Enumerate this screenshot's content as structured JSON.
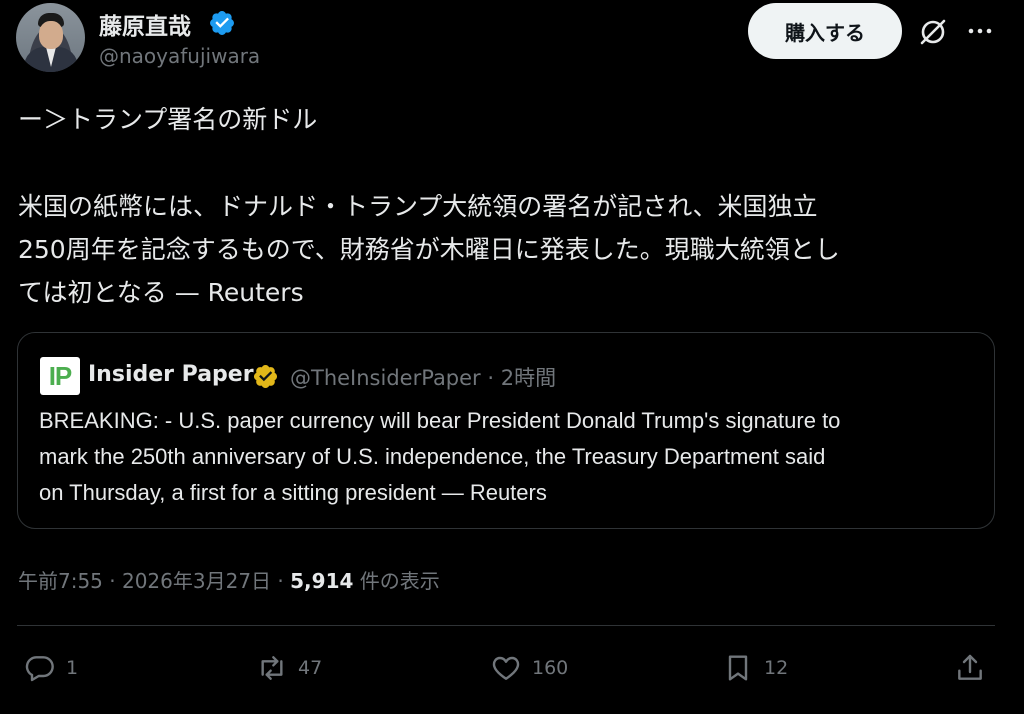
{
  "author": {
    "name": "藤原直哉",
    "handle": "@naoyafujiwara",
    "avatar_icon": "avatar-photo"
  },
  "header": {
    "buy_label": "購入する",
    "grok_icon": "grok-icon",
    "more_icon": "more-icon"
  },
  "tweet": {
    "line1": "ー＞トランプ署名の新ドル",
    "line2": "米国の紙幣には、ドナルド・トランプ大統領の署名が記され、米国独立",
    "line3": "250周年を記念するもので、財務省が木曜日に発表した。現職大統領とし",
    "line4": "ては初となる — Reuters"
  },
  "quote": {
    "logo_text": "IP",
    "name": "Insider Paper",
    "handle_time": "@TheInsiderPaper · 2時間",
    "line1": "BREAKING: - U.S. paper currency will bear President Donald Trump's signature to",
    "line2": "mark the 250th anniversary of U.S. independence, the Treasury Department said",
    "line3": "on Thursday, a first for a sitting president — Reuters"
  },
  "meta": {
    "time_date": "午前7:55 · 2026年3月27日 · ",
    "views": "5,914",
    "views_label": " 件の表示"
  },
  "actions": {
    "replies": "1",
    "reposts": "47",
    "likes": "160",
    "bookmarks": "12"
  },
  "colors": {
    "background": "#000000",
    "text": "#e7e9ea",
    "muted": "#71767b",
    "verified_blue": "#1d9bf0",
    "verified_gold": "#e2b719",
    "border": "#2f3336"
  }
}
